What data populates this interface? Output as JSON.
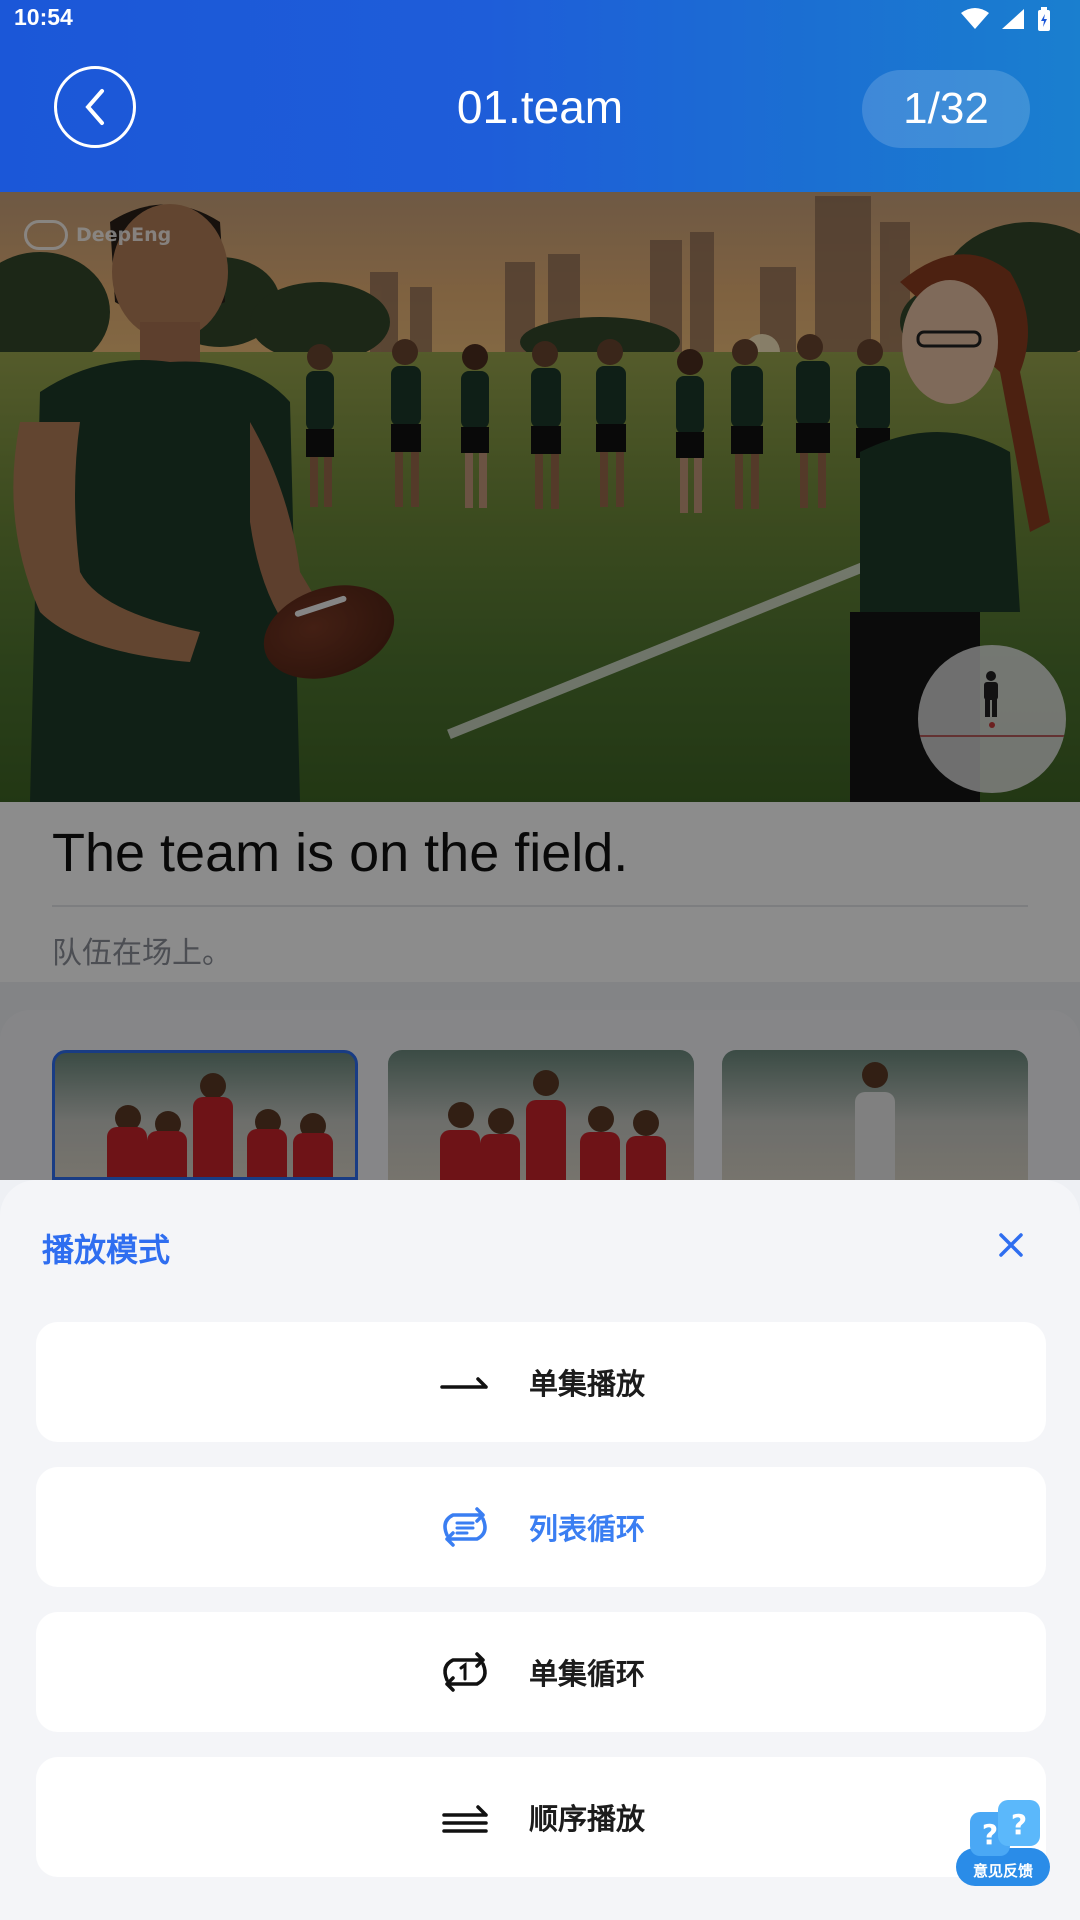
{
  "status_bar": {
    "time": "10:54"
  },
  "header": {
    "title": "01.team",
    "counter": "1/32"
  },
  "scene": {
    "watermark": "DeepEng"
  },
  "sentence": {
    "english": "The team is on the field.",
    "chinese": "队伍在场上。"
  },
  "sheet": {
    "title": "播放模式",
    "options": [
      {
        "label": "单集播放",
        "icon": "single-play-icon",
        "active": false
      },
      {
        "label": "列表循环",
        "icon": "list-loop-icon",
        "active": true
      },
      {
        "label": "单集循环",
        "icon": "single-loop-icon",
        "active": false
      },
      {
        "label": "顺序播放",
        "icon": "sequential-play-icon",
        "active": false
      }
    ]
  },
  "feedback": {
    "label": "意见反馈"
  },
  "colors": {
    "accent": "#2f6ef0",
    "active_option": "#3a7ef2",
    "header": "#1b57d8"
  }
}
